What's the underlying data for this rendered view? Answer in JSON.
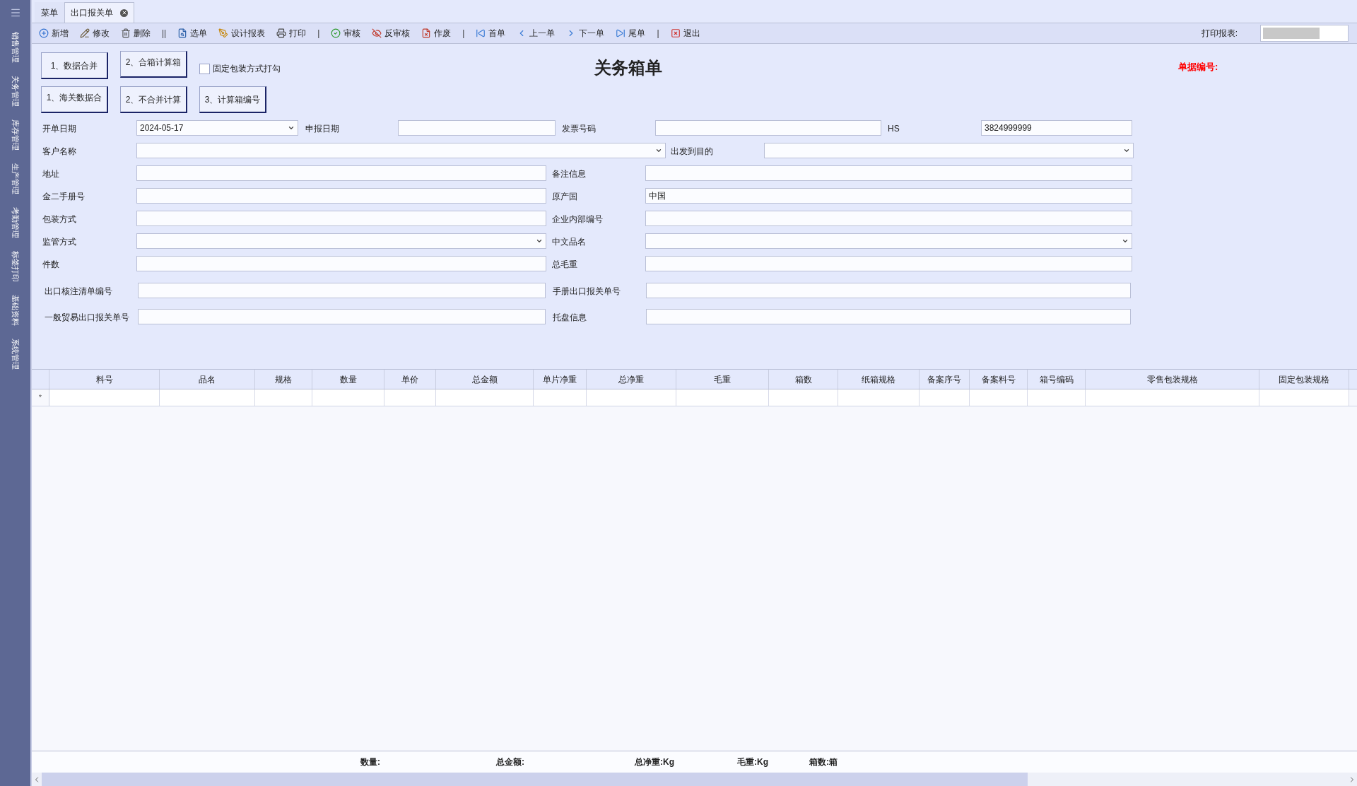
{
  "sidebar": {
    "items": [
      {
        "label": "销售管理",
        "selected": false
      },
      {
        "label": "关务管理",
        "selected": false
      },
      {
        "label": "库存管理",
        "selected": false
      },
      {
        "label": "生产管理",
        "selected": false
      },
      {
        "label": "考勤管理",
        "selected": false
      },
      {
        "label": "标签打印",
        "selected": false
      },
      {
        "label": "基础资料",
        "selected": false
      },
      {
        "label": "系统管理",
        "selected": false
      }
    ]
  },
  "tabs": [
    {
      "label": "菜单",
      "selected": false,
      "closable": false
    },
    {
      "label": "出口报关单",
      "selected": true,
      "closable": true
    }
  ],
  "toolbar": {
    "items": [
      {
        "kind": "button",
        "label": "新增"
      },
      {
        "kind": "button",
        "label": "修改"
      },
      {
        "kind": "button",
        "label": "删除"
      },
      {
        "kind": "separator",
        "label": "||"
      },
      {
        "kind": "button",
        "label": "选单"
      },
      {
        "kind": "button",
        "label": "设计报表"
      },
      {
        "kind": "button",
        "label": "打印"
      },
      {
        "kind": "separator",
        "label": "|"
      },
      {
        "kind": "button",
        "label": "审核"
      },
      {
        "kind": "button",
        "label": "反审核"
      },
      {
        "kind": "button",
        "label": "作废"
      },
      {
        "kind": "separator",
        "label": "|"
      },
      {
        "kind": "button",
        "label": "首单"
      },
      {
        "kind": "button",
        "label": "上一单"
      },
      {
        "kind": "button",
        "label": "下一单"
      },
      {
        "kind": "button",
        "label": "尾单"
      },
      {
        "kind": "separator",
        "label": "|"
      },
      {
        "kind": "button",
        "label": "退出"
      }
    ],
    "report_label": "打印报表:"
  },
  "actions": {
    "row_1": [
      "1、数据合并",
      "2、合箱计算箱"
    ],
    "fixed_packing_checkbox": {
      "label": "固定包装方式打勾",
      "checked": false
    },
    "row_2": [
      "1、海关数据合",
      "2、不合并计算",
      "3、计算箱编号"
    ]
  },
  "title": "关务箱单",
  "doc_number_label": "单据编号:",
  "form": {
    "rows": [
      [
        {
          "label": "开单日期",
          "value": "2024-05-17",
          "kind": "dropdown"
        },
        {
          "label": "申报日期",
          "kind": "text"
        },
        {
          "label": "发票号码",
          "kind": "text"
        },
        {
          "label": "HS",
          "value": "3824999999",
          "kind": "text"
        }
      ],
      [
        {
          "label": "客户名称",
          "kind": "dropdown"
        },
        {
          "label": "出发到目的",
          "kind": "dropdown"
        }
      ],
      [
        {
          "label": "地址",
          "kind": "text"
        },
        {
          "label": "备注信息",
          "kind": "text"
        }
      ],
      [
        {
          "label": "金二手册号",
          "kind": "text"
        },
        {
          "label": "原产国",
          "value": "中国",
          "kind": "text"
        }
      ],
      [
        {
          "label": "包装方式",
          "kind": "text"
        },
        {
          "label": "企业内部编号",
          "kind": "text"
        }
      ],
      [
        {
          "label": "监管方式",
          "kind": "dropdown"
        },
        {
          "label": "中文品名",
          "kind": "dropdown"
        }
      ],
      [
        {
          "label": "件数",
          "kind": "text"
        },
        {
          "label": "总毛重",
          "kind": "text"
        }
      ],
      [
        {
          "label": "出口核注清单编号",
          "kind": "text"
        },
        {
          "label": "手册出口报关单号",
          "kind": "text"
        }
      ],
      [
        {
          "label": "一般贸易出口报关单号",
          "kind": "text"
        },
        {
          "label": "托盘信息",
          "kind": "text"
        }
      ]
    ]
  },
  "table": {
    "columns": [
      "料号",
      "品名",
      "规格",
      "数量",
      "单价",
      "总金额",
      "单片净重",
      "总净重",
      "毛重",
      "箱数",
      "纸箱规格",
      "备案序号",
      "备案料号",
      "箱号编码",
      "零售包装规格",
      "固定包装规格"
    ],
    "new_row_marker": "*"
  },
  "footer": {
    "totals": [
      "数量:",
      "总金额:",
      "总净重:Kg",
      "毛重:Kg",
      "箱数:箱"
    ]
  }
}
